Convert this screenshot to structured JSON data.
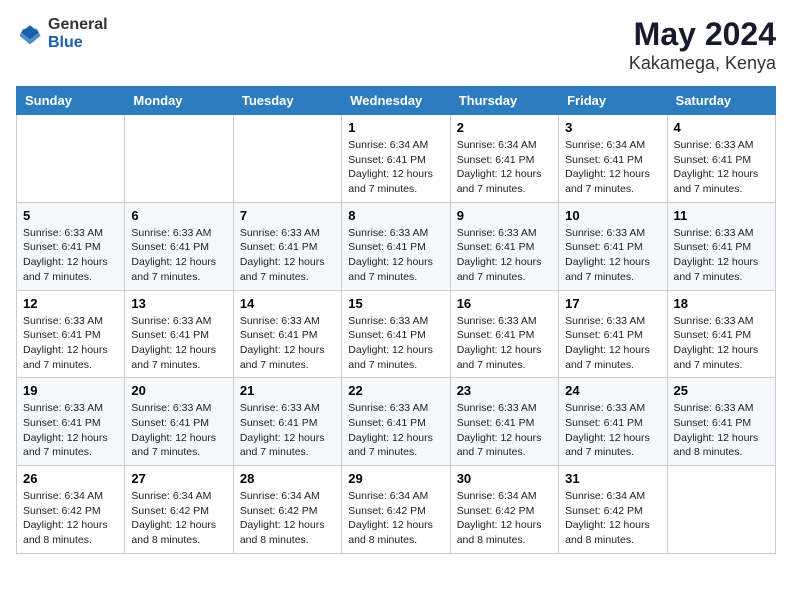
{
  "logo": {
    "general": "General",
    "blue": "Blue"
  },
  "title": {
    "month": "May 2024",
    "location": "Kakamega, Kenya"
  },
  "weekdays": [
    "Sunday",
    "Monday",
    "Tuesday",
    "Wednesday",
    "Thursday",
    "Friday",
    "Saturday"
  ],
  "weeks": [
    [
      {
        "day": "",
        "info": ""
      },
      {
        "day": "",
        "info": ""
      },
      {
        "day": "",
        "info": ""
      },
      {
        "day": "1",
        "info": "Sunrise: 6:34 AM\nSunset: 6:41 PM\nDaylight: 12 hours and 7 minutes."
      },
      {
        "day": "2",
        "info": "Sunrise: 6:34 AM\nSunset: 6:41 PM\nDaylight: 12 hours and 7 minutes."
      },
      {
        "day": "3",
        "info": "Sunrise: 6:34 AM\nSunset: 6:41 PM\nDaylight: 12 hours and 7 minutes."
      },
      {
        "day": "4",
        "info": "Sunrise: 6:33 AM\nSunset: 6:41 PM\nDaylight: 12 hours and 7 minutes."
      }
    ],
    [
      {
        "day": "5",
        "info": "Sunrise: 6:33 AM\nSunset: 6:41 PM\nDaylight: 12 hours and 7 minutes."
      },
      {
        "day": "6",
        "info": "Sunrise: 6:33 AM\nSunset: 6:41 PM\nDaylight: 12 hours and 7 minutes."
      },
      {
        "day": "7",
        "info": "Sunrise: 6:33 AM\nSunset: 6:41 PM\nDaylight: 12 hours and 7 minutes."
      },
      {
        "day": "8",
        "info": "Sunrise: 6:33 AM\nSunset: 6:41 PM\nDaylight: 12 hours and 7 minutes."
      },
      {
        "day": "9",
        "info": "Sunrise: 6:33 AM\nSunset: 6:41 PM\nDaylight: 12 hours and 7 minutes."
      },
      {
        "day": "10",
        "info": "Sunrise: 6:33 AM\nSunset: 6:41 PM\nDaylight: 12 hours and 7 minutes."
      },
      {
        "day": "11",
        "info": "Sunrise: 6:33 AM\nSunset: 6:41 PM\nDaylight: 12 hours and 7 minutes."
      }
    ],
    [
      {
        "day": "12",
        "info": "Sunrise: 6:33 AM\nSunset: 6:41 PM\nDaylight: 12 hours and 7 minutes."
      },
      {
        "day": "13",
        "info": "Sunrise: 6:33 AM\nSunset: 6:41 PM\nDaylight: 12 hours and 7 minutes."
      },
      {
        "day": "14",
        "info": "Sunrise: 6:33 AM\nSunset: 6:41 PM\nDaylight: 12 hours and 7 minutes."
      },
      {
        "day": "15",
        "info": "Sunrise: 6:33 AM\nSunset: 6:41 PM\nDaylight: 12 hours and 7 minutes."
      },
      {
        "day": "16",
        "info": "Sunrise: 6:33 AM\nSunset: 6:41 PM\nDaylight: 12 hours and 7 minutes."
      },
      {
        "day": "17",
        "info": "Sunrise: 6:33 AM\nSunset: 6:41 PM\nDaylight: 12 hours and 7 minutes."
      },
      {
        "day": "18",
        "info": "Sunrise: 6:33 AM\nSunset: 6:41 PM\nDaylight: 12 hours and 7 minutes."
      }
    ],
    [
      {
        "day": "19",
        "info": "Sunrise: 6:33 AM\nSunset: 6:41 PM\nDaylight: 12 hours and 7 minutes."
      },
      {
        "day": "20",
        "info": "Sunrise: 6:33 AM\nSunset: 6:41 PM\nDaylight: 12 hours and 7 minutes."
      },
      {
        "day": "21",
        "info": "Sunrise: 6:33 AM\nSunset: 6:41 PM\nDaylight: 12 hours and 7 minutes."
      },
      {
        "day": "22",
        "info": "Sunrise: 6:33 AM\nSunset: 6:41 PM\nDaylight: 12 hours and 7 minutes."
      },
      {
        "day": "23",
        "info": "Sunrise: 6:33 AM\nSunset: 6:41 PM\nDaylight: 12 hours and 7 minutes."
      },
      {
        "day": "24",
        "info": "Sunrise: 6:33 AM\nSunset: 6:41 PM\nDaylight: 12 hours and 7 minutes."
      },
      {
        "day": "25",
        "info": "Sunrise: 6:33 AM\nSunset: 6:41 PM\nDaylight: 12 hours and 8 minutes."
      }
    ],
    [
      {
        "day": "26",
        "info": "Sunrise: 6:34 AM\nSunset: 6:42 PM\nDaylight: 12 hours and 8 minutes."
      },
      {
        "day": "27",
        "info": "Sunrise: 6:34 AM\nSunset: 6:42 PM\nDaylight: 12 hours and 8 minutes."
      },
      {
        "day": "28",
        "info": "Sunrise: 6:34 AM\nSunset: 6:42 PM\nDaylight: 12 hours and 8 minutes."
      },
      {
        "day": "29",
        "info": "Sunrise: 6:34 AM\nSunset: 6:42 PM\nDaylight: 12 hours and 8 minutes."
      },
      {
        "day": "30",
        "info": "Sunrise: 6:34 AM\nSunset: 6:42 PM\nDaylight: 12 hours and 8 minutes."
      },
      {
        "day": "31",
        "info": "Sunrise: 6:34 AM\nSunset: 6:42 PM\nDaylight: 12 hours and 8 minutes."
      },
      {
        "day": "",
        "info": ""
      }
    ]
  ]
}
